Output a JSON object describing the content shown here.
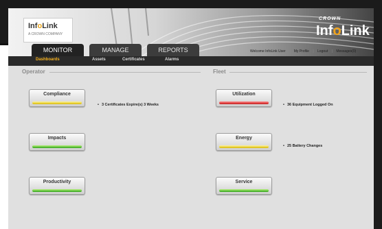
{
  "header": {
    "logo_left": {
      "prefix": "Inf",
      "accent": "o",
      "suffix": "Link",
      "tagline": "A CROWN COMPANY"
    },
    "brand_small": "CROWN",
    "logo_right": {
      "prefix": "Inf",
      "accent": "o",
      "suffix": "Link"
    }
  },
  "tabs": [
    {
      "label": "MONITOR",
      "active": true
    },
    {
      "label": "MANAGE",
      "active": false
    },
    {
      "label": "REPORTS",
      "active": false
    }
  ],
  "user_links": {
    "welcome": "Welcome InfoLink User",
    "profile": "My Profile",
    "logout": "Logout",
    "messages": "Messages(0)"
  },
  "subnav": [
    {
      "label": "Dashboards",
      "active": true
    },
    {
      "label": "Assets",
      "active": false
    },
    {
      "label": "Certificates",
      "active": false
    },
    {
      "label": "Alarms",
      "active": false
    }
  ],
  "operator": {
    "title": "Operator",
    "buttons": [
      {
        "label": "Compliance",
        "status_color": "yellow",
        "note": "3 Certificates Expire(s) 3 Weeks"
      },
      {
        "label": "Impacts",
        "status_color": "green",
        "note": ""
      },
      {
        "label": "Productivity",
        "status_color": "green",
        "note": ""
      }
    ]
  },
  "fleet": {
    "title": "Fleet",
    "buttons": [
      {
        "label": "Utilization",
        "status_color": "red",
        "note": "36 Equipment Logged On"
      },
      {
        "label": "Energy",
        "status_color": "yellow",
        "note": "25 Battery Changes"
      },
      {
        "label": "Service",
        "status_color": "green",
        "note": ""
      }
    ]
  },
  "colors": {
    "accent": "#f0a21a",
    "yellow": "#d8b800",
    "green": "#2fa21a",
    "red": "#c41818"
  }
}
